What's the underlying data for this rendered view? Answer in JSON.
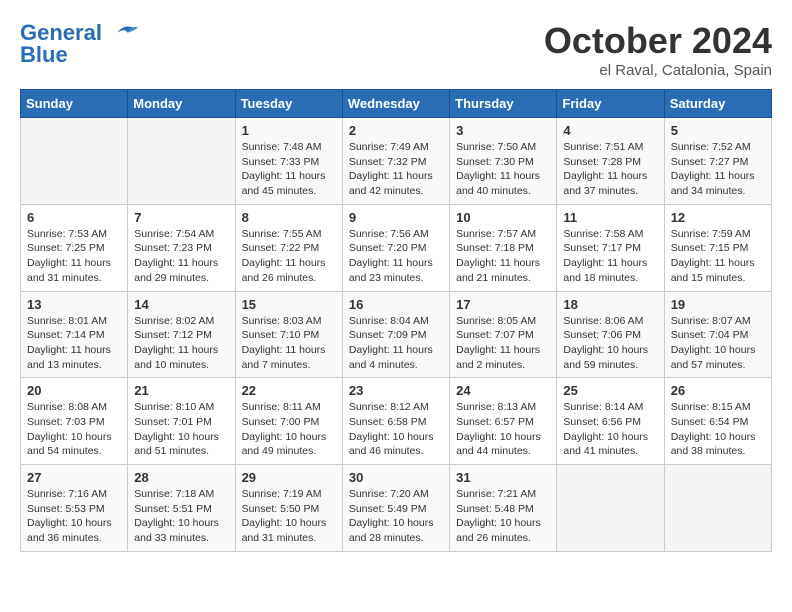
{
  "header": {
    "logo_line1": "General",
    "logo_line2": "Blue",
    "month": "October 2024",
    "location": "el Raval, Catalonia, Spain"
  },
  "weekdays": [
    "Sunday",
    "Monday",
    "Tuesday",
    "Wednesday",
    "Thursday",
    "Friday",
    "Saturday"
  ],
  "weeks": [
    [
      {
        "day": "",
        "info": ""
      },
      {
        "day": "",
        "info": ""
      },
      {
        "day": "1",
        "info": "Sunrise: 7:48 AM\nSunset: 7:33 PM\nDaylight: 11 hours\nand 45 minutes."
      },
      {
        "day": "2",
        "info": "Sunrise: 7:49 AM\nSunset: 7:32 PM\nDaylight: 11 hours\nand 42 minutes."
      },
      {
        "day": "3",
        "info": "Sunrise: 7:50 AM\nSunset: 7:30 PM\nDaylight: 11 hours\nand 40 minutes."
      },
      {
        "day": "4",
        "info": "Sunrise: 7:51 AM\nSunset: 7:28 PM\nDaylight: 11 hours\nand 37 minutes."
      },
      {
        "day": "5",
        "info": "Sunrise: 7:52 AM\nSunset: 7:27 PM\nDaylight: 11 hours\nand 34 minutes."
      }
    ],
    [
      {
        "day": "6",
        "info": "Sunrise: 7:53 AM\nSunset: 7:25 PM\nDaylight: 11 hours\nand 31 minutes."
      },
      {
        "day": "7",
        "info": "Sunrise: 7:54 AM\nSunset: 7:23 PM\nDaylight: 11 hours\nand 29 minutes."
      },
      {
        "day": "8",
        "info": "Sunrise: 7:55 AM\nSunset: 7:22 PM\nDaylight: 11 hours\nand 26 minutes."
      },
      {
        "day": "9",
        "info": "Sunrise: 7:56 AM\nSunset: 7:20 PM\nDaylight: 11 hours\nand 23 minutes."
      },
      {
        "day": "10",
        "info": "Sunrise: 7:57 AM\nSunset: 7:18 PM\nDaylight: 11 hours\nand 21 minutes."
      },
      {
        "day": "11",
        "info": "Sunrise: 7:58 AM\nSunset: 7:17 PM\nDaylight: 11 hours\nand 18 minutes."
      },
      {
        "day": "12",
        "info": "Sunrise: 7:59 AM\nSunset: 7:15 PM\nDaylight: 11 hours\nand 15 minutes."
      }
    ],
    [
      {
        "day": "13",
        "info": "Sunrise: 8:01 AM\nSunset: 7:14 PM\nDaylight: 11 hours\nand 13 minutes."
      },
      {
        "day": "14",
        "info": "Sunrise: 8:02 AM\nSunset: 7:12 PM\nDaylight: 11 hours\nand 10 minutes."
      },
      {
        "day": "15",
        "info": "Sunrise: 8:03 AM\nSunset: 7:10 PM\nDaylight: 11 hours\nand 7 minutes."
      },
      {
        "day": "16",
        "info": "Sunrise: 8:04 AM\nSunset: 7:09 PM\nDaylight: 11 hours\nand 4 minutes."
      },
      {
        "day": "17",
        "info": "Sunrise: 8:05 AM\nSunset: 7:07 PM\nDaylight: 11 hours\nand 2 minutes."
      },
      {
        "day": "18",
        "info": "Sunrise: 8:06 AM\nSunset: 7:06 PM\nDaylight: 10 hours\nand 59 minutes."
      },
      {
        "day": "19",
        "info": "Sunrise: 8:07 AM\nSunset: 7:04 PM\nDaylight: 10 hours\nand 57 minutes."
      }
    ],
    [
      {
        "day": "20",
        "info": "Sunrise: 8:08 AM\nSunset: 7:03 PM\nDaylight: 10 hours\nand 54 minutes."
      },
      {
        "day": "21",
        "info": "Sunrise: 8:10 AM\nSunset: 7:01 PM\nDaylight: 10 hours\nand 51 minutes."
      },
      {
        "day": "22",
        "info": "Sunrise: 8:11 AM\nSunset: 7:00 PM\nDaylight: 10 hours\nand 49 minutes."
      },
      {
        "day": "23",
        "info": "Sunrise: 8:12 AM\nSunset: 6:58 PM\nDaylight: 10 hours\nand 46 minutes."
      },
      {
        "day": "24",
        "info": "Sunrise: 8:13 AM\nSunset: 6:57 PM\nDaylight: 10 hours\nand 44 minutes."
      },
      {
        "day": "25",
        "info": "Sunrise: 8:14 AM\nSunset: 6:56 PM\nDaylight: 10 hours\nand 41 minutes."
      },
      {
        "day": "26",
        "info": "Sunrise: 8:15 AM\nSunset: 6:54 PM\nDaylight: 10 hours\nand 38 minutes."
      }
    ],
    [
      {
        "day": "27",
        "info": "Sunrise: 7:16 AM\nSunset: 5:53 PM\nDaylight: 10 hours\nand 36 minutes."
      },
      {
        "day": "28",
        "info": "Sunrise: 7:18 AM\nSunset: 5:51 PM\nDaylight: 10 hours\nand 33 minutes."
      },
      {
        "day": "29",
        "info": "Sunrise: 7:19 AM\nSunset: 5:50 PM\nDaylight: 10 hours\nand 31 minutes."
      },
      {
        "day": "30",
        "info": "Sunrise: 7:20 AM\nSunset: 5:49 PM\nDaylight: 10 hours\nand 28 minutes."
      },
      {
        "day": "31",
        "info": "Sunrise: 7:21 AM\nSunset: 5:48 PM\nDaylight: 10 hours\nand 26 minutes."
      },
      {
        "day": "",
        "info": ""
      },
      {
        "day": "",
        "info": ""
      }
    ]
  ]
}
